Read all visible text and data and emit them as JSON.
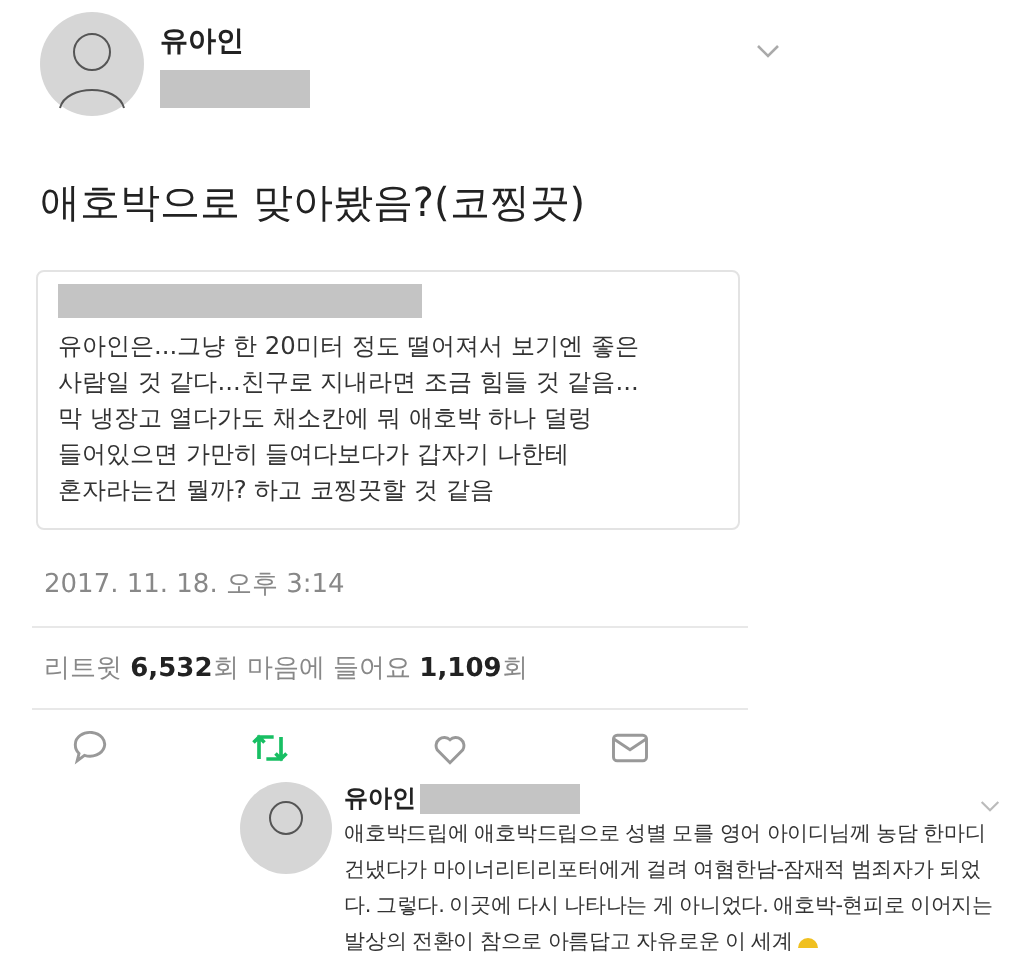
{
  "tweet": {
    "author": "유아인",
    "text": "애호박으로 맞아봤음?(코찡끗)",
    "quote": {
      "lines": [
        "유아인은...그냥 한 20미터 정도 떨어져서 보기엔 좋은",
        "사람일 것 같다...친구로 지내라면 조금 힘들 것 같음...",
        "막 냉장고 열다가도 채소칸에 뭐 애호박 하나 덜렁",
        "들어있으면 가만히 들여다보다가 갑자기 나한테",
        "혼자라는건 뭘까? 하고 코찡끗할 것 같음"
      ]
    },
    "timestamp": "2017. 11. 18. 오후 3:14",
    "stats": "리트윗 **6,532**회  마음에 들어요 **1,109**회",
    "actions": [
      {
        "kind": "reply",
        "on": false
      },
      {
        "kind": "retweet",
        "on": true
      },
      {
        "kind": "like",
        "on": false
      },
      {
        "kind": "message",
        "on": false
      }
    ]
  },
  "reply": {
    "author": "유아인",
    "lines": [
      "애호박드립에 애호박드립으로 성별 모를 영어 아이디님께 농담 한마디",
      "건냈다가 마이너리티리포터에게 걸려 여혐한남-잠재적 범죄자가 되었",
      "다. 그렇다. 이곳에 다시 나타나는 게 아니었다. 애호박-현피로 이어지는",
      "발상의 전환이 참으로 아름답고 자유로운 이 세계"
    ]
  }
}
